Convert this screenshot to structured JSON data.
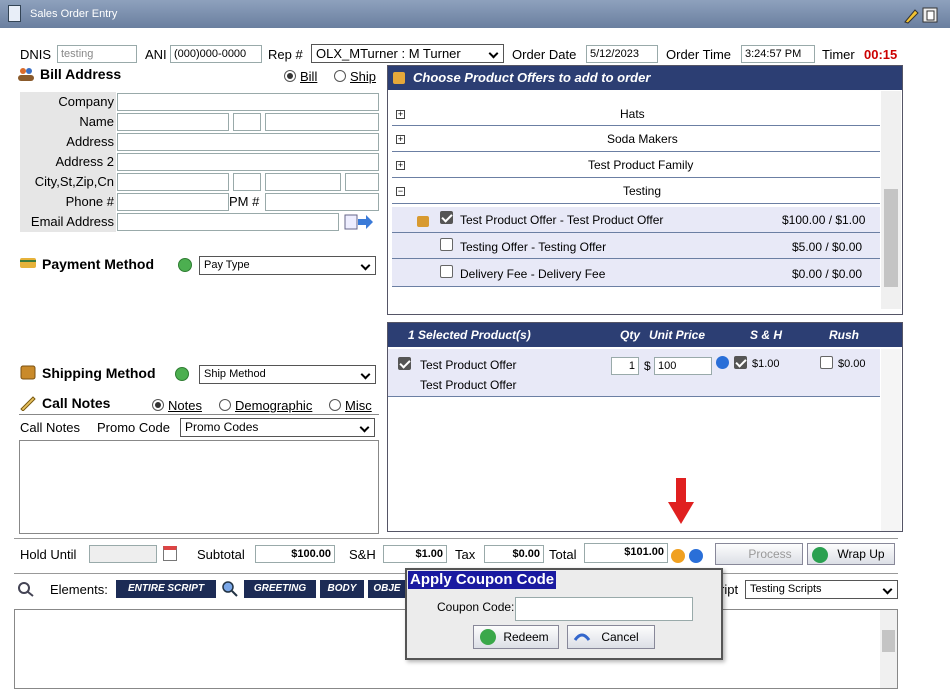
{
  "window": {
    "title": "Sales Order Entry"
  },
  "header": {
    "dnis_label": "DNIS",
    "dnis_value": "testing",
    "ani_label": "ANI",
    "ani_value": "(000)000-0000",
    "rep_label": "Rep #",
    "rep_value": "OLX_MTurner : M Turner",
    "order_date_label": "Order Date",
    "order_date_value": "5/12/2023",
    "order_time_label": "Order Time",
    "order_time_value": "3:24:57 PM",
    "timer_label": "Timer",
    "timer_value": "00:15"
  },
  "bill": {
    "title": "Bill Address",
    "radio_bill": "Bill",
    "radio_ship": "Ship",
    "fields": [
      "Company",
      "Name",
      "Address",
      "Address 2",
      "City,St,Zip,Cn",
      "Phone #",
      "Email Address"
    ],
    "pm_label": "PM #"
  },
  "payment": {
    "title": "Payment Method",
    "select": "Pay Type"
  },
  "shipping": {
    "title": "Shipping Method",
    "select": "Ship Method"
  },
  "notes": {
    "title": "Call Notes",
    "radio_notes": "Notes",
    "radio_demographic": "Demographic",
    "radio_misc": "Misc",
    "call_notes_label": "Call Notes",
    "promo_label": "Promo Code",
    "promo_select": "Promo Codes"
  },
  "offers": {
    "title": "Choose Product Offers to add to order",
    "families": [
      "Hats",
      "Soda Makers",
      "Test Product Family",
      "Testing"
    ],
    "items": [
      {
        "label": "Test Product Offer - Test Product Offer",
        "price": "$100.00 / $1.00",
        "checked": true
      },
      {
        "label": "Testing Offer - Testing Offer",
        "price": "$5.00 / $0.00",
        "checked": false
      },
      {
        "label": "Delivery Fee - Delivery Fee",
        "price": "$0.00 / $0.00",
        "checked": false
      }
    ]
  },
  "selected": {
    "title": "1 Selected Product(s)",
    "col_qty": "Qty",
    "col_unit_price": "Unit Price",
    "col_sh": "S & H",
    "col_rush": "Rush",
    "row": {
      "name": "Test Product Offer",
      "sub": "Test Product Offer",
      "qty": "1",
      "currency": "$",
      "price": "100",
      "sh": "$1.00",
      "rush": "$0.00"
    }
  },
  "totals": {
    "hold_label": "Hold Until",
    "subtotal_label": "Subtotal",
    "subtotal": "$100.00",
    "sh_label": "S&H",
    "sh": "$1.00",
    "tax_label": "Tax",
    "tax": "$0.00",
    "total_label": "Total",
    "total": "$101.00",
    "process": "Process",
    "wrapup": "Wrap Up"
  },
  "script": {
    "elements_label": "Elements:",
    "buttons": [
      "ENTIRE SCRIPT",
      "GREETING",
      "BODY",
      "OBJE"
    ],
    "script_label": "ript",
    "script_select": "Testing Scripts"
  },
  "coupon": {
    "title": "Apply Coupon Code",
    "field_label": "Coupon Code:",
    "redeem": "Redeem",
    "cancel": "Cancel"
  },
  "colors": {
    "navy": "#2c3e73",
    "timer": "#cc0000",
    "arrow": "#e02020"
  }
}
